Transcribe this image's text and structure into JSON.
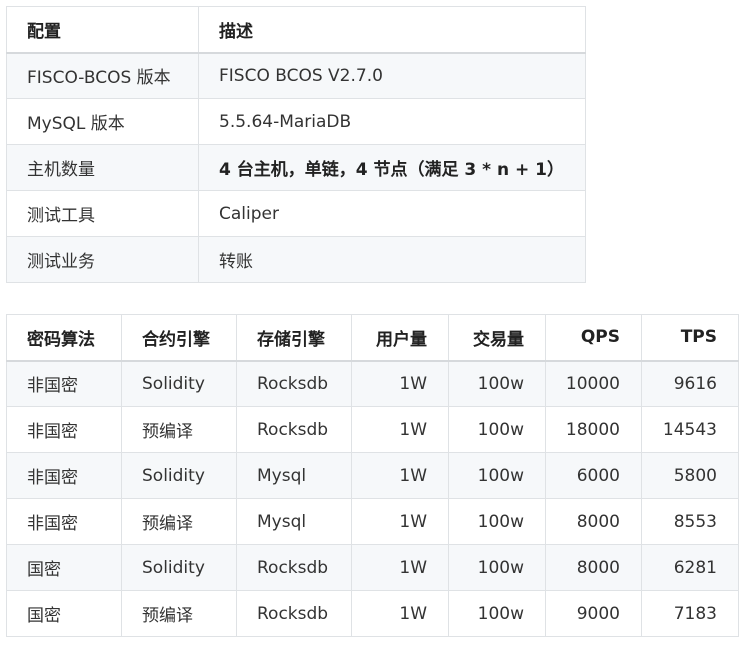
{
  "config_table": {
    "headers": [
      "配置",
      "描述"
    ],
    "rows": [
      [
        "FISCO-BCOS 版本",
        "FISCO BCOS V2.7.0"
      ],
      [
        "MySQL 版本",
        "5.5.64-MariaDB"
      ],
      [
        "主机数量",
        "4 台主机，单链，4 节点（满足 3 * n + 1）"
      ],
      [
        "测试工具",
        "Caliper"
      ],
      [
        "测试业务",
        "转账"
      ]
    ]
  },
  "perf_table": {
    "headers": [
      "密码算法",
      "合约引擎",
      "存储引擎",
      "用户量",
      "交易量",
      "QPS",
      "TPS"
    ],
    "rows": [
      [
        "非国密",
        "Solidity",
        "Rocksdb",
        "1W",
        "100w",
        "10000",
        "9616"
      ],
      [
        "非国密",
        "预编译",
        "Rocksdb",
        "1W",
        "100w",
        "18000",
        "14543"
      ],
      [
        "非国密",
        "Solidity",
        "Mysql",
        "1W",
        "100w",
        "6000",
        "5800"
      ],
      [
        "非国密",
        "预编译",
        "Mysql",
        "1W",
        "100w",
        "8000",
        "8553"
      ],
      [
        "国密",
        "Solidity",
        "Rocksdb",
        "1W",
        "100w",
        "8000",
        "6281"
      ],
      [
        "国密",
        "预编译",
        "Rocksdb",
        "1W",
        "100w",
        "9000",
        "7183"
      ]
    ]
  }
}
